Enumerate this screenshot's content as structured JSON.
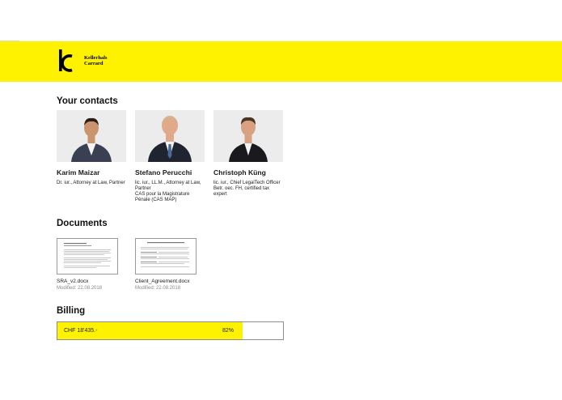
{
  "brand": {
    "name_line1": "Kellerhals",
    "name_line2": "Carrard",
    "accent_color": "#fff200"
  },
  "contacts": {
    "heading": "Your contacts",
    "people": [
      {
        "name": "Karim Maizar",
        "title": "Dr. iur., Attorney at Law, Partner",
        "tie_color": "#2b2b3a",
        "suit_color": "#3a3f52"
      },
      {
        "name": "Stefano Perucchi",
        "title": "lic. iur., LL.M., Attorney at Law, Partner\nCAS pour la Magistrature Pénale (CAS MAP)",
        "tie_color": "#4a6a9a",
        "suit_color": "#1f2430"
      },
      {
        "name": "Christoph Küng",
        "title": "lic. iur., Chief LegalTech Officer\nBetr. oec. FH, certified tax expert",
        "tie_color": "#1a1a1a",
        "suit_color": "#1a1a1e"
      }
    ]
  },
  "documents": {
    "heading": "Documents",
    "files": [
      {
        "name": "SRA_v2.docx",
        "modified": "Modified: 22.08.2018"
      },
      {
        "name": "Client_Agreement.docx",
        "modified": "Modified: 22.08.2018"
      }
    ]
  },
  "billing": {
    "heading": "Billing",
    "amount": "CHF 18'435.-",
    "percent_label": "82%",
    "progress_fraction": 0.82
  }
}
